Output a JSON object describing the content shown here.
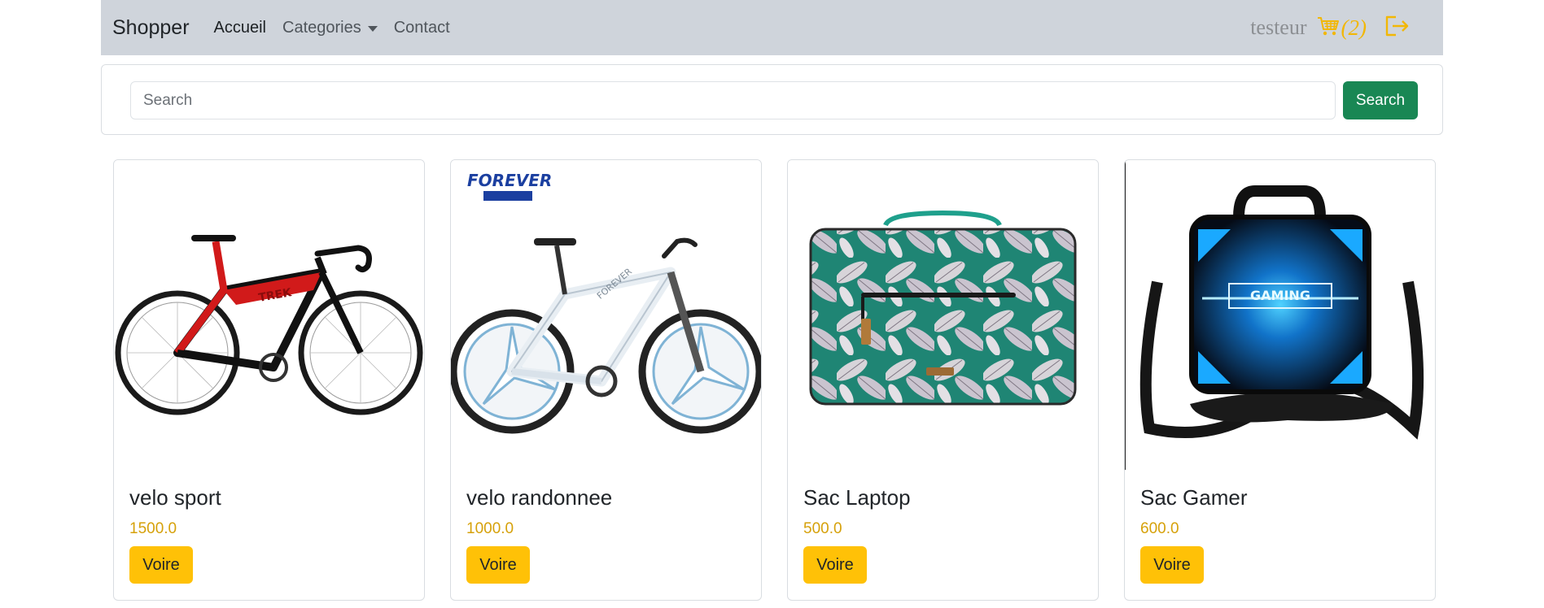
{
  "navbar": {
    "brand": "Shopper",
    "links": [
      {
        "label": "Accueil"
      },
      {
        "label": "Categories"
      },
      {
        "label": "Contact"
      }
    ],
    "username": "testeur",
    "cart_count": "(2)"
  },
  "search": {
    "placeholder": "Search",
    "value": "",
    "button_label": "Search"
  },
  "products": [
    {
      "name": "velo sport",
      "price": "1500.0",
      "button_label": "Voire"
    },
    {
      "name": "velo randonnee",
      "price": "1000.0",
      "button_label": "Voire"
    },
    {
      "name": "Sac Laptop",
      "price": "500.0",
      "button_label": "Voire"
    },
    {
      "name": "Sac Gamer",
      "price": "600.0",
      "button_label": "Voire"
    }
  ],
  "image_texts": {
    "brand_logo": "FOREVER",
    "bag_print": "GAMING"
  },
  "colors": {
    "navbar_bg": "#cfd4db",
    "accent": "#ffc107",
    "price": "#d6a10a",
    "search_button": "#198754",
    "cart_icon": "#f2b705"
  },
  "icons": [
    "cart-icon",
    "logout-icon",
    "chevron-down-icon"
  ]
}
